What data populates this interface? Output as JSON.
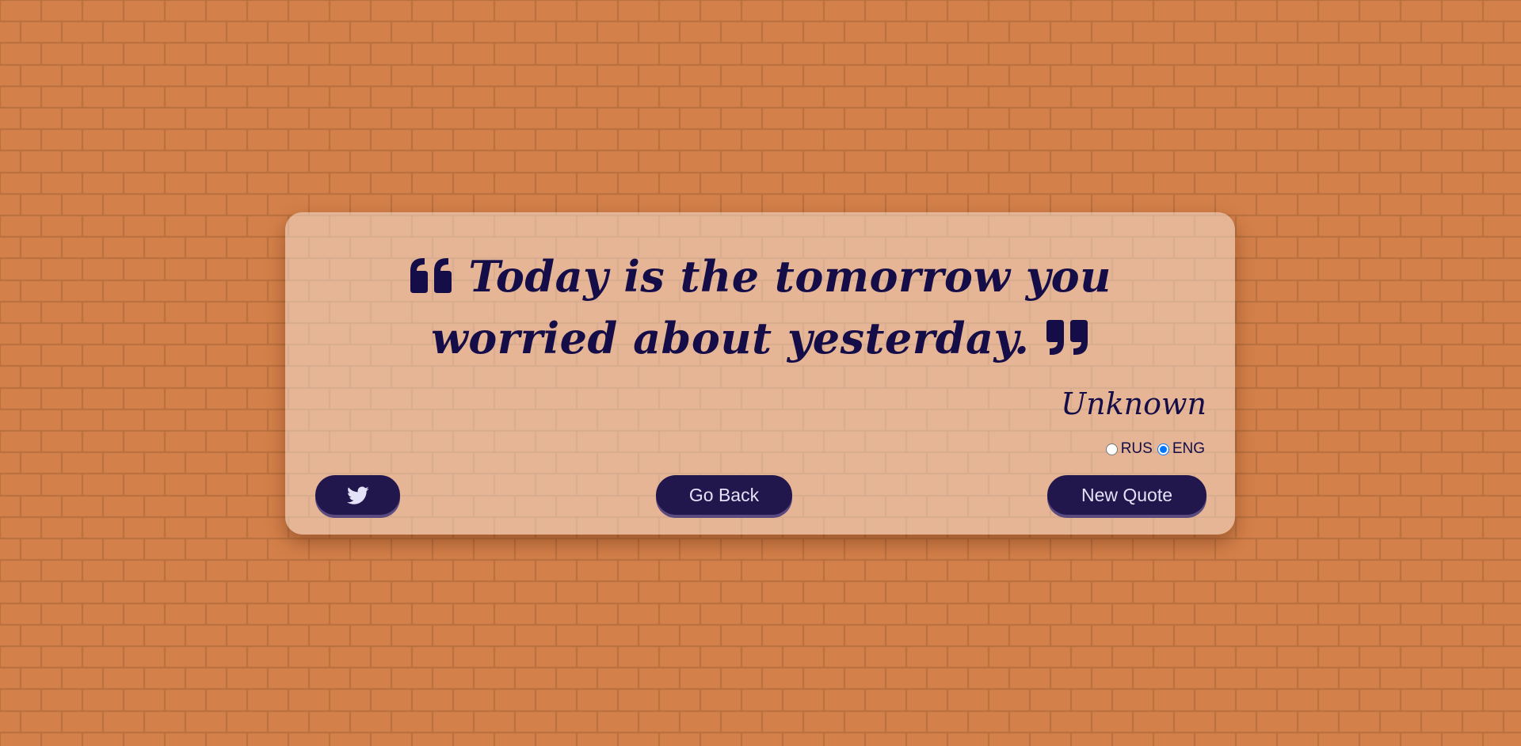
{
  "colors": {
    "brick": "#D4804A",
    "mortar": "#B9703F",
    "text": "#140D48",
    "button": "#22174D"
  },
  "quote": {
    "text": "Today is the tomorrow you worried about yesterday.",
    "open_icon": "quote-left-icon",
    "close_icon": "quote-right-icon"
  },
  "author": "Unknown",
  "language": {
    "options": [
      {
        "label": "RUS",
        "checked": false
      },
      {
        "label": "ENG",
        "checked": true
      }
    ]
  },
  "buttons": {
    "twitter_icon": "twitter-icon",
    "go_back": "Go Back",
    "new_quote": "New Quote"
  }
}
